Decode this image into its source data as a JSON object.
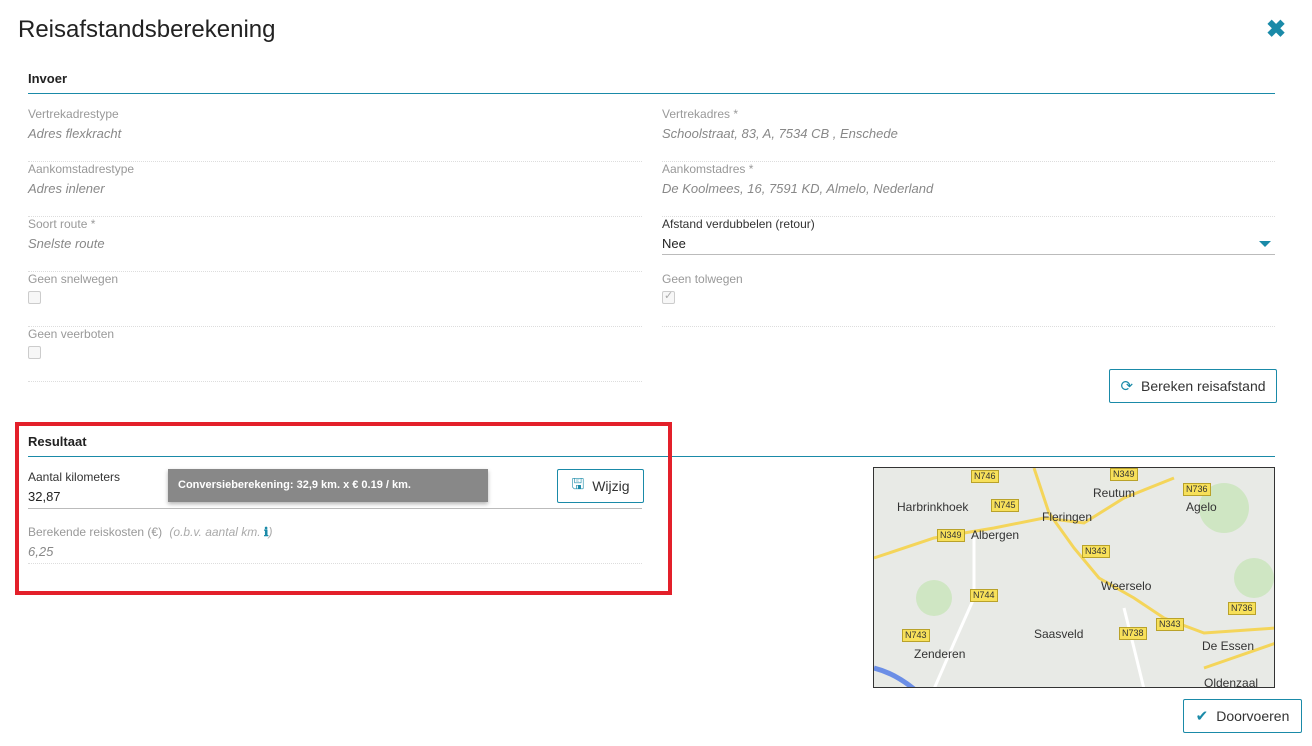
{
  "dialog": {
    "title": "Reisafstandsberekening"
  },
  "input_section": {
    "title": "Invoer",
    "vertrekadrestype": {
      "label": "Vertrekadrestype",
      "value": "Adres flexkracht"
    },
    "vertrekadres": {
      "label": "Vertrekadres *",
      "value": "Schoolstraat, 83, A, 7534 CB , Enschede"
    },
    "aankomstadrestype": {
      "label": "Aankomstadrestype",
      "value": "Adres inlener"
    },
    "aankomstadres": {
      "label": "Aankomstadres *",
      "value": "De Koolmees, 16, 7591 KD, Almelo, Nederland"
    },
    "soort_route": {
      "label": "Soort route *",
      "value": "Snelste route"
    },
    "afstand_verdubbelen": {
      "label": "Afstand verdubbelen (retour)",
      "value": "Nee"
    },
    "geen_snelwegen": {
      "label": "Geen snelwegen",
      "checked": false
    },
    "geen_tolwegen": {
      "label": "Geen tolwegen",
      "checked": true
    },
    "geen_veerboten": {
      "label": "Geen veerboten",
      "checked": false
    },
    "calc_button": "Bereken reisafstand"
  },
  "result_section": {
    "title": "Resultaat",
    "aantal_km": {
      "label": "Aantal kilometers",
      "value": "32,87"
    },
    "tooltip": "Conversieberekening: 32,9 km. x € 0.19 / km.",
    "edit_button": "Wijzig",
    "reiskosten": {
      "label": "Berekende reiskosten (€)",
      "hint": "(o.b.v. aantal km.",
      "hint_close": ")",
      "value": "6,25"
    }
  },
  "map": {
    "towns": [
      "Harbrinkhoek",
      "Albergen",
      "Fleringen",
      "Reutum",
      "Agelo",
      "Weerselo",
      "Saasveld",
      "Zenderen",
      "De Essen",
      "Oldenzaal"
    ],
    "roads": [
      "N746",
      "N349",
      "N736",
      "N745",
      "N349",
      "N343",
      "N744",
      "N736",
      "N743",
      "N738",
      "N343"
    ]
  },
  "footer": {
    "submit_button": "Doorvoeren"
  },
  "colors": {
    "accent": "#1a8aa8",
    "highlight": "#e3202a"
  }
}
